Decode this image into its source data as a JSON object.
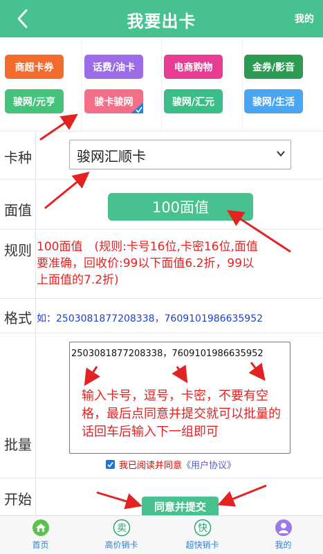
{
  "header": {
    "title": "我要出卡",
    "mine": "我的"
  },
  "categories": [
    {
      "label": "商超卡券",
      "color": "#f26a2c"
    },
    {
      "label": "话费/油卡",
      "color": "#9b6be8"
    },
    {
      "label": "电商购物",
      "color": "#e83c92"
    },
    {
      "label": "金券/影音",
      "color": "#2b9a52"
    },
    {
      "label": "骏网/元亨",
      "color": "#45c27c"
    },
    {
      "label": "骏卡骏网",
      "color": "#f36f88",
      "selected": true
    },
    {
      "label": "骏网/汇元",
      "color": "#3bbe86"
    },
    {
      "label": "骏网/生活",
      "color": "#4aa5f2"
    }
  ],
  "form": {
    "card_type_label": "卡种",
    "card_type_value": "骏网汇顺卡",
    "face_label": "面值",
    "face_value": "100面值",
    "rule_label": "规则",
    "rule_text": "100面值　(规则:卡号16位,卡密16位,面值要准确，回收价:99以下面值6.2折，99以上面值的7.2折)",
    "format_label": "格式",
    "format_text": "如：2503081877208338，7609101986635952",
    "batch_label": "批量",
    "batch_value": "2503081877208338，7609101986635952",
    "batch_hint": "输入卡号，逗号，卡密，不要有空格，最后点同意并提交就可以批量的话回车后输入下一组即可",
    "agree_text": "我已阅读并同意",
    "agree_link": "《用户协议》",
    "start_label": "开始",
    "submit_label": "同意并提交"
  },
  "tabbar": [
    {
      "label": "首页",
      "icon": "home-icon"
    },
    {
      "label": "高价销卡",
      "icon": "mai-icon",
      "glyph": "卖"
    },
    {
      "label": "超快销卡",
      "icon": "kuai-icon",
      "glyph": "快"
    },
    {
      "label": "我的",
      "icon": "user-icon"
    }
  ],
  "colors": {
    "accent": "#47c28f",
    "highlight_red": "#e32222",
    "format_blue": "#1a3fd4"
  }
}
